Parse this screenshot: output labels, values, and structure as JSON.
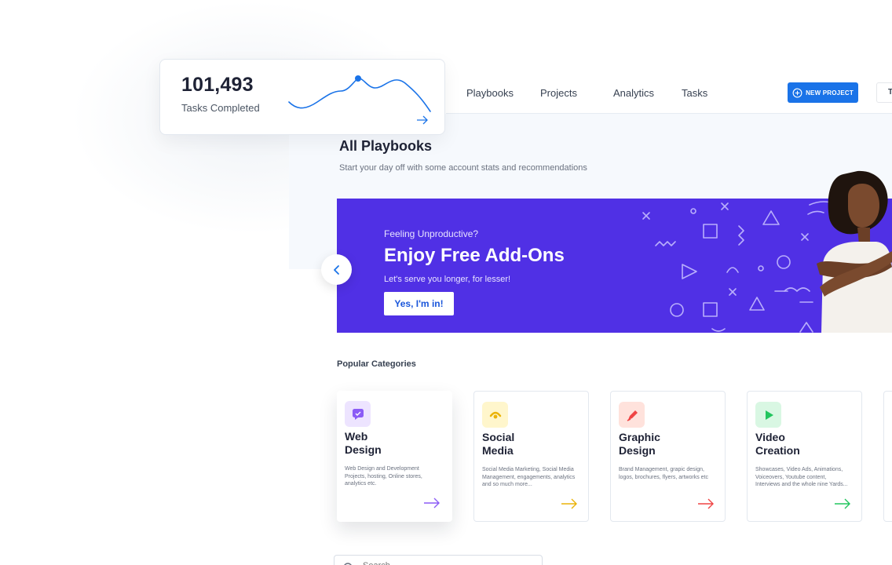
{
  "stats": {
    "value": "101,493",
    "label": "Tasks Completed"
  },
  "nav": {
    "items": [
      "Playbooks",
      "Projects",
      "Analytics",
      "Tasks"
    ],
    "new_project_label": "NEW PROJECT",
    "secondary_button_label": "T"
  },
  "page": {
    "title": "All Playbooks",
    "subtitle": "Start your day off with some account stats and recommendations"
  },
  "banner": {
    "eyebrow": "Feeling Unproductive?",
    "title": "Enjoy Free Add-Ons",
    "description": "Let's serve you longer, for lesser!",
    "cta": "Yes, I'm in!"
  },
  "categories": {
    "heading": "Popular Categories",
    "items": [
      {
        "title_line1": "Web",
        "title_line2": "Design",
        "description": "Web Design and Development Projects, hosting, Online stores, analytics etc.",
        "color": "#8b5cf6",
        "icon": "chat-icon"
      },
      {
        "title_line1": "Social",
        "title_line2": "Media",
        "description": "Social Media Marketing, Social Media Management, engagements, analytics and so much more...",
        "color": "#eab308",
        "icon": "broadcast-icon"
      },
      {
        "title_line1": "Graphic",
        "title_line2": "Design",
        "description": "Brand Management, grapic design, logos, brochures, flyers, artworks etc",
        "color": "#ef4444",
        "icon": "pen-icon"
      },
      {
        "title_line1": "Video",
        "title_line2": "Creation",
        "description": "Showcases, Video Ads, Animations, Voiceovers, Youtube content, Interviews and the whole nine Yards...",
        "color": "#22c55e",
        "icon": "play-icon"
      }
    ]
  },
  "search": {
    "placeholder": "Search"
  },
  "colors": {
    "primary": "#1a73e8",
    "banner": "#5030e5"
  }
}
